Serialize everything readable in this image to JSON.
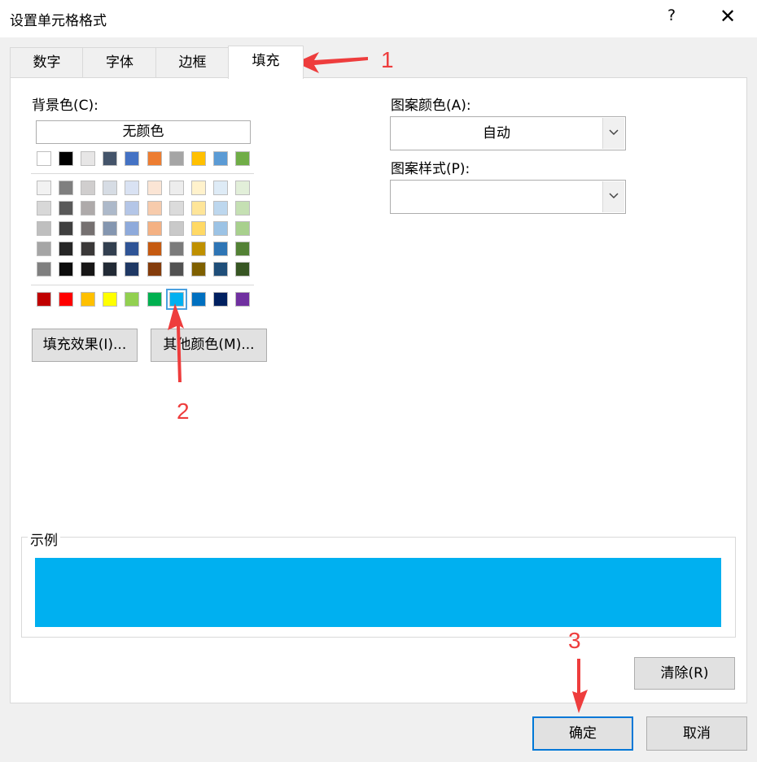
{
  "window": {
    "title": "设置单元格格式",
    "help": "?",
    "close": "✕"
  },
  "tabs": [
    {
      "label": "数字",
      "active": false
    },
    {
      "label": "字体",
      "active": false
    },
    {
      "label": "边框",
      "active": false
    },
    {
      "label": "填充",
      "active": true
    }
  ],
  "fill": {
    "background_label": "背景色(C):",
    "no_color": "无颜色",
    "theme_row": [
      "#ffffff",
      "#000000",
      "#e7e6e6",
      "#44546a",
      "#4472c4",
      "#ed7d31",
      "#a5a5a5",
      "#ffc000",
      "#5b9bd5",
      "#70ad47"
    ],
    "theme_shades": [
      [
        "#f2f2f2",
        "#7f7f7f",
        "#d0cece",
        "#d6dce4",
        "#d9e2f3",
        "#fbe5d5",
        "#ededed",
        "#fff2cc",
        "#deebf6",
        "#e2efd9"
      ],
      [
        "#d8d8d8",
        "#595959",
        "#aeaaaa",
        "#adb9ca",
        "#b4c6e7",
        "#f7cbac",
        "#dbdbdb",
        "#fee599",
        "#bdd7ee",
        "#c5e0b3"
      ],
      [
        "#bfbfbf",
        "#3f3f3f",
        "#757070",
        "#8496b0",
        "#8eaadb",
        "#f4b183",
        "#c9c9c9",
        "#ffd965",
        "#9cc3e5",
        "#a8d08d"
      ],
      [
        "#a5a5a5",
        "#262626",
        "#3a3838",
        "#323f4f",
        "#2f5496",
        "#c55a11",
        "#7b7b7b",
        "#bf9000",
        "#2e75b5",
        "#538135"
      ],
      [
        "#7f7f7f",
        "#0c0c0c",
        "#171616",
        "#222a35",
        "#1f3864",
        "#843c0b",
        "#525252",
        "#7f6000",
        "#1f4e79",
        "#375623"
      ]
    ],
    "standard_row": [
      "#c00000",
      "#ff0000",
      "#ffc000",
      "#ffff00",
      "#92d050",
      "#00b050",
      "#00b0f0",
      "#0070c0",
      "#002060",
      "#7030a0"
    ],
    "selected_standard_index": 6,
    "fill_effects_button": "填充效果(I)...",
    "more_colors_button": "其他颜色(M)...",
    "pattern_color_label": "图案颜色(A):",
    "pattern_color_value": "自动",
    "pattern_style_label": "图案样式(P):",
    "pattern_style_value": ""
  },
  "sample": {
    "label": "示例",
    "color": "#00b0f0"
  },
  "buttons": {
    "clear": "清除(R)",
    "ok": "确定",
    "cancel": "取消"
  },
  "annotations": [
    "1",
    "2",
    "3"
  ],
  "colors": {
    "annotation": "#ee3d3d",
    "focus": "#0078d7"
  }
}
